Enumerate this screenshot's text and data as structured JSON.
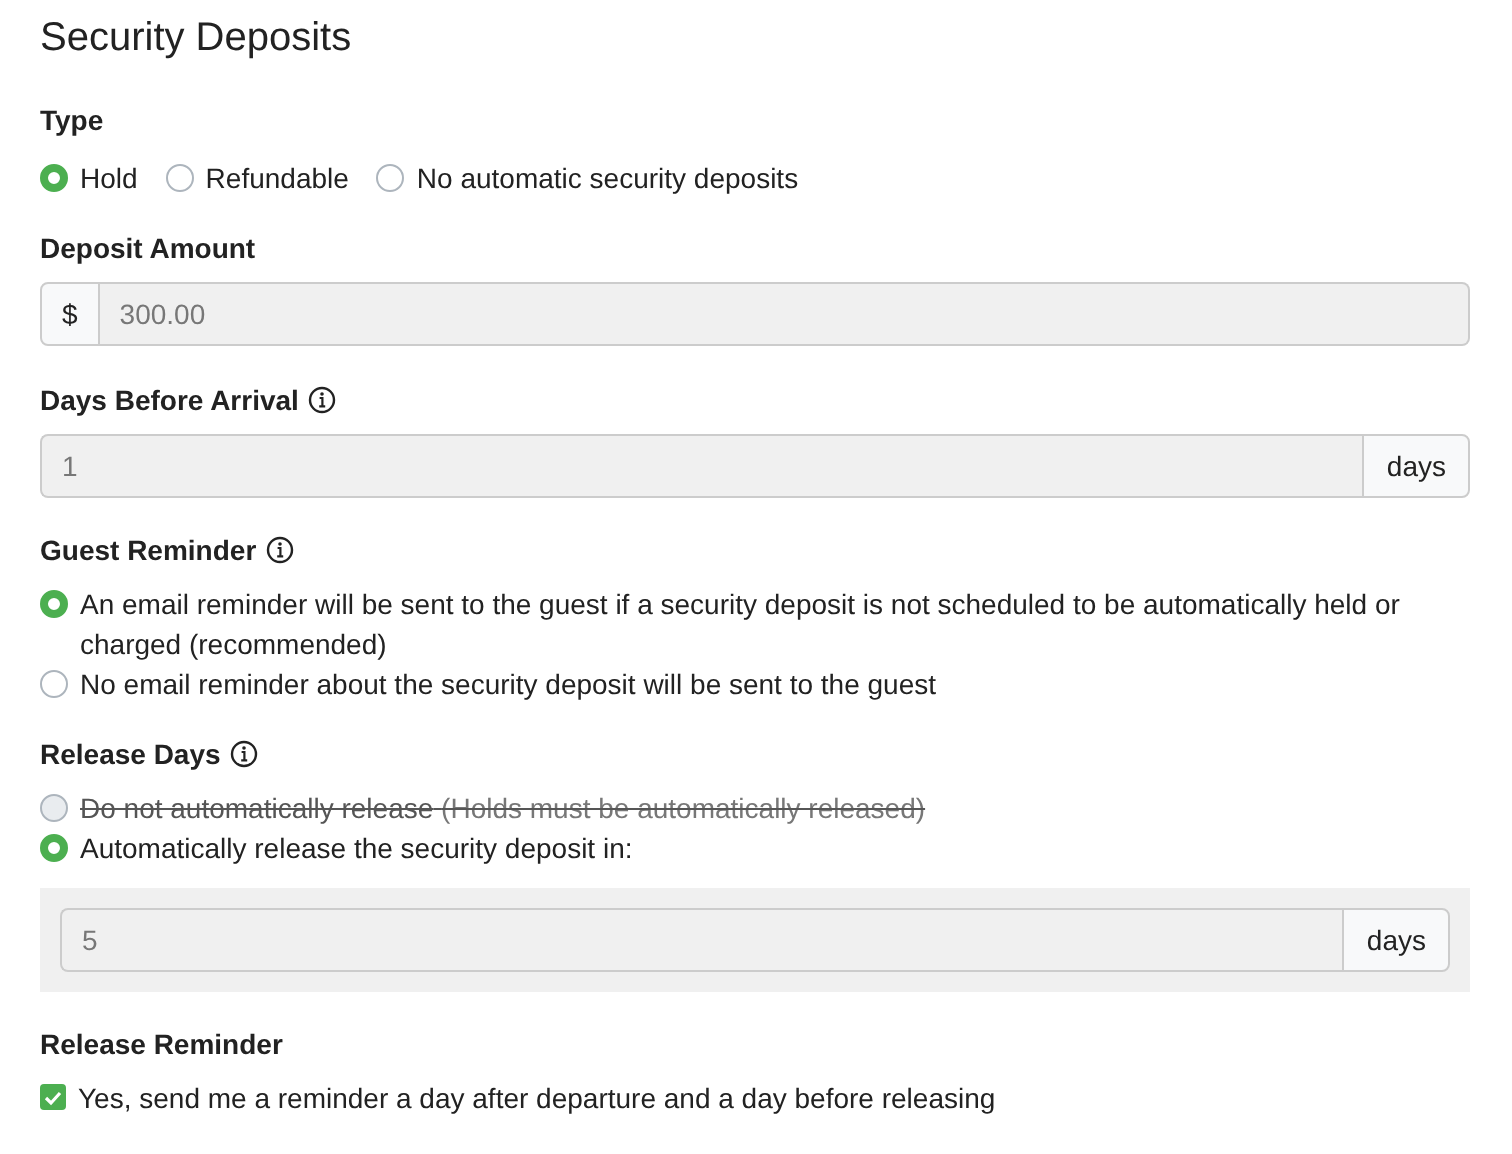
{
  "title": "Security Deposits",
  "type": {
    "label": "Type",
    "options": [
      {
        "label": "Hold",
        "selected": true
      },
      {
        "label": "Refundable",
        "selected": false
      },
      {
        "label": "No automatic security deposits",
        "selected": false
      }
    ]
  },
  "deposit_amount": {
    "label": "Deposit Amount",
    "prefix": "$",
    "value": "300.00"
  },
  "days_before_arrival": {
    "label": "Days Before Arrival",
    "value": "1",
    "suffix": "days"
  },
  "guest_reminder": {
    "label": "Guest Reminder",
    "options": [
      {
        "label": "An email reminder will be sent to the guest if a security deposit is not scheduled to be automatically held or charged (recommended)",
        "selected": true,
        "disabled": false
      },
      {
        "label": "No email reminder about the security deposit will be sent to the guest",
        "selected": false,
        "disabled": false
      }
    ]
  },
  "release_days": {
    "label": "Release Days",
    "options": [
      {
        "label": "Do not automatically release",
        "note": "(Holds must be automatically released)",
        "selected": false,
        "disabled": true
      },
      {
        "label": "Automatically release the security deposit in:",
        "selected": true,
        "disabled": false
      }
    ],
    "value": "5",
    "suffix": "days"
  },
  "release_reminder": {
    "label": "Release Reminder",
    "checkbox": {
      "label": "Yes, send me a reminder a day after departure and a day before releasing",
      "checked": true
    }
  }
}
